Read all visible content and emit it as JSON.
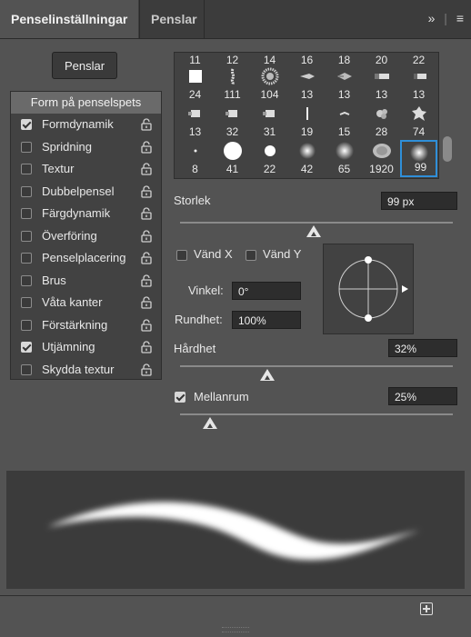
{
  "tabs": [
    {
      "label": "Penselinställningar",
      "active": true
    },
    {
      "label": "Penslar",
      "active": false
    }
  ],
  "tab_icons": {
    "expand": "»",
    "separator": "|",
    "menu": "≡"
  },
  "penslar_button": "Penslar",
  "sidebar": {
    "header": "Form på penselspets",
    "items": [
      {
        "label": "Formdynamik",
        "checked": true
      },
      {
        "label": "Spridning",
        "checked": false
      },
      {
        "label": "Textur",
        "checked": false
      },
      {
        "label": "Dubbelpensel",
        "checked": false
      },
      {
        "label": "Färgdynamik",
        "checked": false
      },
      {
        "label": "Överföring",
        "checked": false
      },
      {
        "label": "Penselplacering",
        "checked": false
      },
      {
        "label": "Brus",
        "checked": false
      },
      {
        "label": "Våta kanter",
        "checked": false
      },
      {
        "label": "Förstärkning",
        "checked": false
      },
      {
        "label": "Utjämning",
        "checked": true
      },
      {
        "label": "Skydda textur",
        "checked": false
      }
    ]
  },
  "presets": {
    "row0": [
      "11",
      "12",
      "14",
      "16",
      "18",
      "20",
      "22"
    ],
    "row1": [
      "24",
      "111",
      "104",
      "13",
      "13",
      "13",
      "13"
    ],
    "row2": [
      "13",
      "32",
      "31",
      "19",
      "15",
      "28",
      "74"
    ],
    "row3": [
      "8",
      "41",
      "22",
      "42",
      "65",
      "1920",
      "99"
    ],
    "selected": "99"
  },
  "size": {
    "label": "Storlek",
    "value": "99 px",
    "slider_fraction": 0.49
  },
  "flip_x": {
    "label": "Vänd X",
    "checked": false
  },
  "flip_y": {
    "label": "Vänd Y",
    "checked": false
  },
  "angle": {
    "label": "Vinkel:",
    "value": "0°"
  },
  "roundness": {
    "label": "Rundhet:",
    "value": "100%"
  },
  "hardness": {
    "label": "Hårdhet",
    "value": "32%",
    "slider_fraction": 0.32
  },
  "spacing": {
    "label": "Mellanrum",
    "value": "25%",
    "checked": true,
    "slider_fraction": 0.11
  },
  "icons": [
    "lock-icon",
    "checkbox-icon",
    "new-brush-icon",
    "menu-icon",
    "expand-icon"
  ]
}
